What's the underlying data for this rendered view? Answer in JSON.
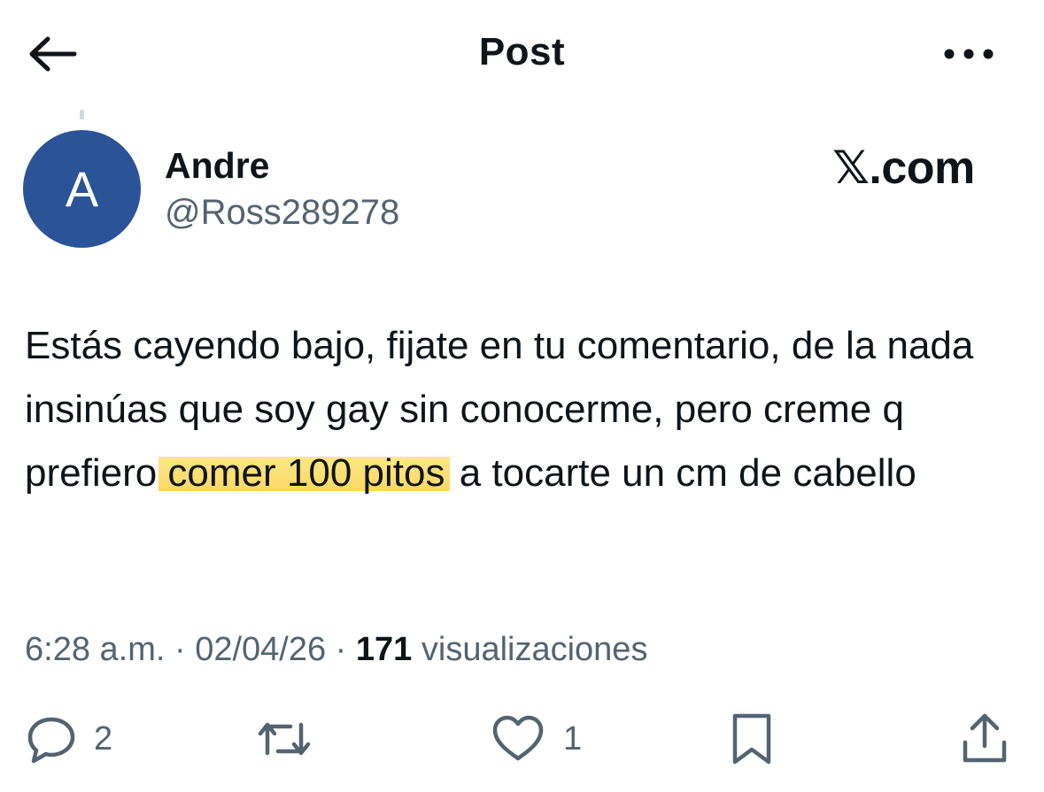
{
  "header": {
    "title": "Post",
    "back_icon": "arrow-left-icon",
    "more_icon": "more-horizontal-icon"
  },
  "author": {
    "avatar_initial": "A",
    "avatar_color": "#2a5398",
    "name": "Andre",
    "handle": "@Ross289278"
  },
  "watermark": "𝕏.com",
  "tweet": {
    "text_before": "Estás cayendo bajo, fijate en tu comentario, de la nada insinúas que soy gay sin conocerme, pero creme q prefiero ",
    "text_highlight": "comer 100 pitos",
    "text_after": " a tocarte un cm de cabello",
    "highlight_color": "#fbd760"
  },
  "meta": {
    "time": "6:28 a.m.",
    "sep1": " · ",
    "date": "02/04/26",
    "sep2": " · ",
    "views_count": "171",
    "views_label": " visualizaciones"
  },
  "actions": {
    "reply_icon": "reply-icon",
    "reply_count": "2",
    "repost_icon": "repost-icon",
    "like_icon": "heart-icon",
    "like_count": "1",
    "bookmark_icon": "bookmark-icon",
    "share_icon": "share-icon"
  }
}
